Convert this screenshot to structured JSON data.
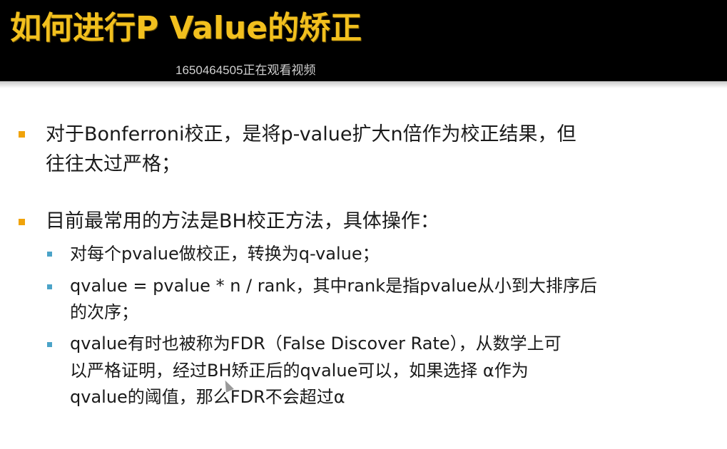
{
  "title": "如何进行P Value的矫正",
  "watermark": "1650464505正在观看视频",
  "bullets": [
    {
      "lines": [
        "对于Bonferroni校正，是将p-value扩大n倍作为校正结果，但",
        "往往太过严格；"
      ]
    },
    {
      "lines": [
        "目前最常用的方法是BH校正方法，具体操作："
      ],
      "sub": [
        {
          "lines": [
            "对每个pvalue做校正，转换为q-value；"
          ]
        },
        {
          "lines": [
            "qvalue = pvalue * n / rank，其中rank是指pvalue从小到大排序后",
            "的次序；"
          ]
        },
        {
          "lines": [
            "qvalue有时也被称为FDR（False Discover Rate），从数学上可",
            "以严格证明，经过BH矫正后的qvalue可以，如果选择 α作为",
            "qvalue的阈值，那么FDR不会超过α"
          ]
        }
      ]
    }
  ],
  "colors": {
    "title": "#f2c01e",
    "title_bar": "#000000",
    "bullet_l1": "#f0a30a",
    "bullet_l2": "#4ba3c8"
  }
}
